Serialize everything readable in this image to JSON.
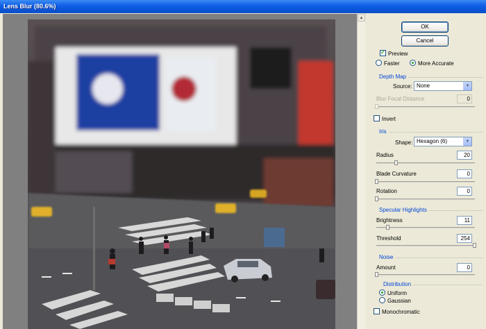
{
  "window": {
    "title": "Lens Blur (80.6%)"
  },
  "buttons": {
    "ok": "OK",
    "cancel": "Cancel"
  },
  "preview": {
    "label": "Preview",
    "checked": true,
    "faster": "Faster",
    "more_accurate": "More Accurate",
    "selected": "More Accurate"
  },
  "depth_map": {
    "title": "Depth Map",
    "source_label": "Source:",
    "source_value": "None",
    "blur_focal_label": "Blur Focal Distance",
    "blur_focal_value": "0",
    "invert_label": "Invert",
    "invert_checked": false
  },
  "iris": {
    "title": "Iris",
    "shape_label": "Shape:",
    "shape_value": "Hexagon (6)",
    "radius_label": "Radius",
    "radius_value": "20",
    "radius_level": 0.2,
    "blade_label": "Blade Curvature",
    "blade_value": "0",
    "blade_level": 0,
    "rotation_label": "Rotation",
    "rotation_value": "0",
    "rotation_level": 0
  },
  "specular": {
    "title": "Specular Highlights",
    "brightness_label": "Brightness",
    "brightness_value": "11",
    "brightness_level": 0.11,
    "threshold_label": "Threshold",
    "threshold_value": "254",
    "threshold_level": 0.996
  },
  "noise": {
    "title": "Noise",
    "amount_label": "Amount",
    "amount_value": "0",
    "amount_level": 0,
    "distribution_title": "Distribution",
    "uniform": "Uniform",
    "gaussian": "Gaussian",
    "selected": "Uniform",
    "mono_label": "Monochromatic",
    "mono_checked": false
  },
  "colors": {
    "title_bar": "#0a55d8",
    "group_title": "#0046d5",
    "check": "#21a121"
  }
}
